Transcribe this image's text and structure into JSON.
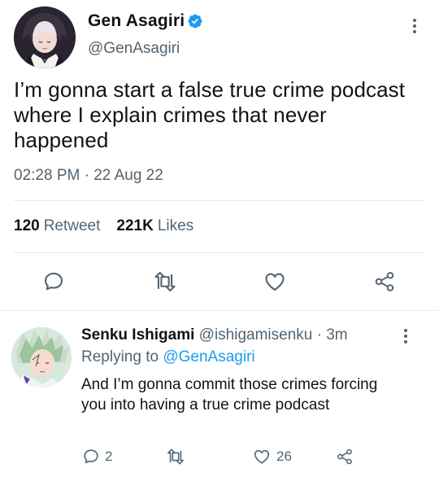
{
  "tweet": {
    "display_name": "Gen Asagiri",
    "handle": "@GenAsagiri",
    "text": "I’m gonna start a false true crime podcast where I explain crimes that never happened",
    "timestamp": "02:28 PM · 22 Aug 22",
    "retweet_count": "120",
    "retweet_label": "Retweet",
    "like_count": "221K",
    "like_label": "Likes",
    "verified": true
  },
  "reply": {
    "display_name": "Senku Ishigami",
    "handle_time": "@ishigamisenku · 3m",
    "replying_prefix": "Replying to",
    "replying_to": "@GenAsagiri",
    "text": "And I’m gonna commit those crimes forcing you into having a true crime podcast",
    "reply_count": "2",
    "like_count": "26"
  },
  "icons": [
    "verified-badge-icon",
    "more-icon",
    "reply-icon",
    "retweet-icon",
    "like-icon",
    "share-icon"
  ],
  "colors": {
    "accent": "#1d9bf0",
    "text": "#0f1419",
    "muted": "#536471",
    "divider": "#e7e9ea"
  }
}
